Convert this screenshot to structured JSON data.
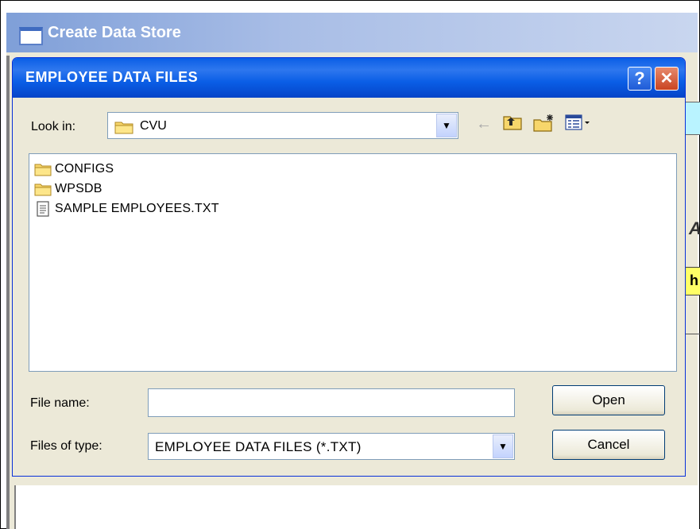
{
  "background_window": {
    "title": "Create Data Store",
    "fragment_italic": "A",
    "fragment_yellow": "h"
  },
  "dialog": {
    "title": "EMPLOYEE DATA FILES",
    "help_label": "?",
    "close_label": "✕"
  },
  "look_in": {
    "label": "Look in:",
    "value": "CVU"
  },
  "files": [
    {
      "name": "CONFIGS",
      "icon": "folder-icon"
    },
    {
      "name": "WPSDB",
      "icon": "folder-icon"
    },
    {
      "name": "SAMPLE EMPLOYEES.TXT",
      "icon": "text-file-icon"
    }
  ],
  "file_name": {
    "label": "File name:",
    "value": "",
    "placeholder": ""
  },
  "file_type": {
    "label": "Files of type:",
    "value": "EMPLOYEE DATA FILES (*.TXT)"
  },
  "buttons": {
    "open": "Open",
    "cancel": "Cancel"
  },
  "colors": {
    "titlebar": "#0a5ee6",
    "dialog_bg": "#ece9d8",
    "bg_title": "#a8bde6"
  }
}
